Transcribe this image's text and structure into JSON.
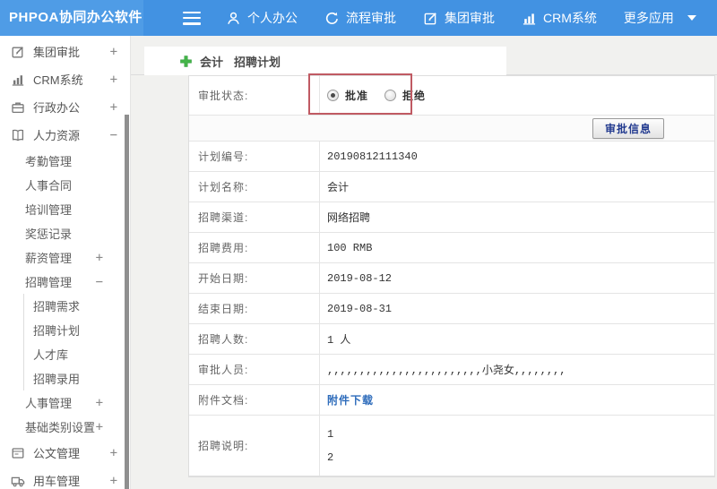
{
  "colors": {
    "topbar_bg": "#4292e2",
    "logo_bg": "#4f9ce6",
    "accent_green": "#44b549",
    "annotation_red": "#c05a63",
    "link_blue": "#2e6cbb",
    "button_text_blue": "#223a8f"
  },
  "topbar": {
    "logo": "PHPOA协同办公软件",
    "menu": [
      {
        "label": "个人办公",
        "icon": "user-icon"
      },
      {
        "label": "流程审批",
        "icon": "history-icon"
      },
      {
        "label": "集团审批",
        "icon": "edit-icon"
      },
      {
        "label": "CRM系统",
        "icon": "bar-chart-icon"
      },
      {
        "label": "更多应用",
        "caret": true
      }
    ]
  },
  "sidebar": {
    "items": [
      {
        "label": "集团审批",
        "icon": "edit-icon",
        "expander": "+",
        "level": 0
      },
      {
        "label": "CRM系统",
        "icon": "bar-chart-icon",
        "expander": "+",
        "level": 0
      },
      {
        "label": "行政办公",
        "icon": "briefcase-icon",
        "expander": "+",
        "level": 0
      },
      {
        "label": "人力资源",
        "icon": "book-icon",
        "expander": "−",
        "level": 0
      },
      {
        "label": "考勤管理",
        "level": 1
      },
      {
        "label": "人事合同",
        "level": 1
      },
      {
        "label": "培训管理",
        "level": 1
      },
      {
        "label": "奖惩记录",
        "level": 1
      },
      {
        "label": "薪资管理",
        "expander": "+",
        "level": 1
      },
      {
        "label": "招聘管理",
        "expander": "−",
        "level": 1
      },
      {
        "label": "招聘需求",
        "level": 2
      },
      {
        "label": "招聘计划",
        "level": 2
      },
      {
        "label": "人才库",
        "level": 2
      },
      {
        "label": "招聘录用",
        "level": 2
      },
      {
        "label": "人事管理",
        "expander": "+",
        "level": 1
      },
      {
        "label": "基础类别设置",
        "expander": "+",
        "level": 1
      },
      {
        "label": "公文管理",
        "icon": "document-icon",
        "expander": "+",
        "level": 0
      },
      {
        "label": "用车管理",
        "icon": "truck-icon",
        "expander": "+",
        "level": 0
      }
    ]
  },
  "main": {
    "title": {
      "part1": "会计",
      "part2": "招聘计划"
    },
    "approval": {
      "label": "审批状态:",
      "options": [
        {
          "label": "批准",
          "selected": true
        },
        {
          "label": "拒绝",
          "selected": false
        }
      ],
      "info_button": "审批信息"
    },
    "fields": [
      {
        "label": "计划编号:",
        "value": "20190812111340"
      },
      {
        "label": "计划名称:",
        "value": "会计"
      },
      {
        "label": "招聘渠道:",
        "value": "网络招聘"
      },
      {
        "label": "招聘费用:",
        "value": "100 RMB"
      },
      {
        "label": "开始日期:",
        "value": "2019-08-12"
      },
      {
        "label": "结束日期:",
        "value": "2019-08-31"
      },
      {
        "label": "招聘人数:",
        "value": "1 人"
      },
      {
        "label": "审批人员:",
        "value": ",,,,,,,,,,,,,,,,,,,,,,,,小尧女,,,,,,,,"
      },
      {
        "label": "附件文档:",
        "value": "附件下载",
        "type": "link"
      },
      {
        "label": "招聘说明:",
        "value": [
          "1",
          "2"
        ],
        "type": "multiline"
      }
    ]
  }
}
